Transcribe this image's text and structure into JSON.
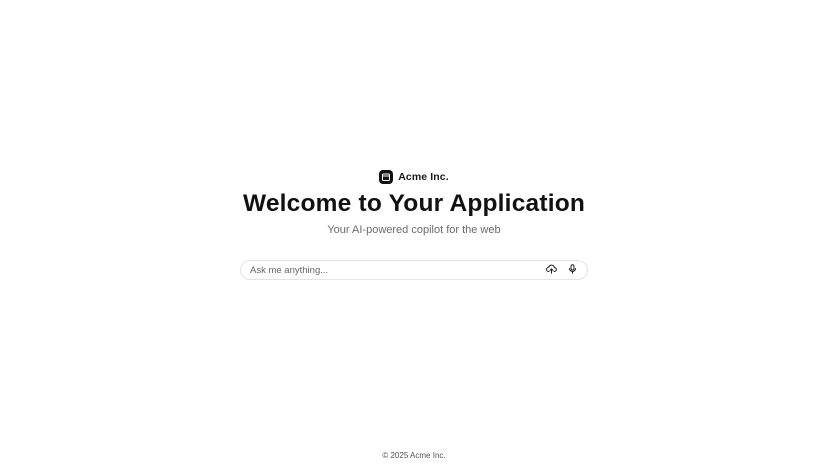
{
  "brand": {
    "logo_icon": "window-icon",
    "name": "Acme Inc."
  },
  "hero": {
    "title": "Welcome to Your Application",
    "subtitle": "Your AI-powered copilot for the web"
  },
  "search": {
    "placeholder": "Ask me anything...",
    "value": "",
    "upload_icon": "cloud-upload-icon",
    "mic_icon": "microphone-icon"
  },
  "footer": {
    "text": "© 2025 Acme Inc."
  }
}
